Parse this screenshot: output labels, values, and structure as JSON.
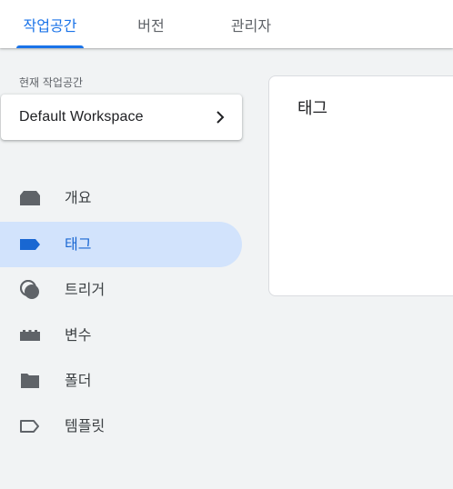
{
  "tabs": [
    {
      "label": "작업공간",
      "active": true
    },
    {
      "label": "버전",
      "active": false
    },
    {
      "label": "관리자",
      "active": false
    }
  ],
  "sidebar": {
    "workspace_label": "현재 작업공간",
    "workspace_name": "Default Workspace",
    "items": [
      {
        "label": "개요",
        "icon": "overview-icon",
        "active": false
      },
      {
        "label": "태그",
        "icon": "tag-icon",
        "active": true
      },
      {
        "label": "트리거",
        "icon": "trigger-icon",
        "active": false
      },
      {
        "label": "변수",
        "icon": "variable-icon",
        "active": false
      },
      {
        "label": "폴더",
        "icon": "folder-icon",
        "active": false
      },
      {
        "label": "템플릿",
        "icon": "template-icon",
        "active": false
      }
    ]
  },
  "main": {
    "card_title": "태그"
  },
  "colors": {
    "accent": "#1a73e8",
    "active_bg": "#d2e3fc",
    "icon": "#5f6368",
    "active_icon": "#1967d2"
  }
}
